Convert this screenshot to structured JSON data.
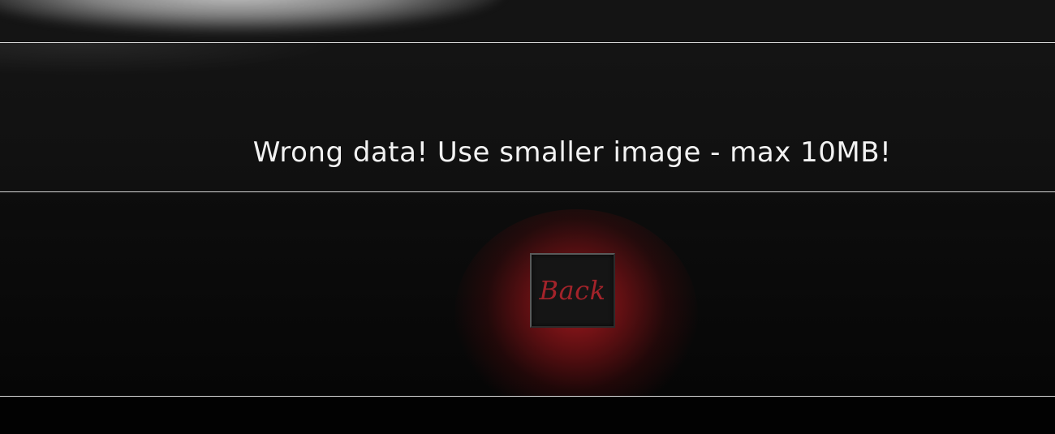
{
  "message": {
    "text": "Wrong data! Use smaller image - max 10MB!"
  },
  "actions": {
    "back_label": "Back"
  },
  "colors": {
    "background": "#0f0f0f",
    "divider": "#d8d8d8",
    "message_text": "#f2f2f2",
    "button_text": "#a3232a",
    "button_glow": "#a5191e"
  }
}
